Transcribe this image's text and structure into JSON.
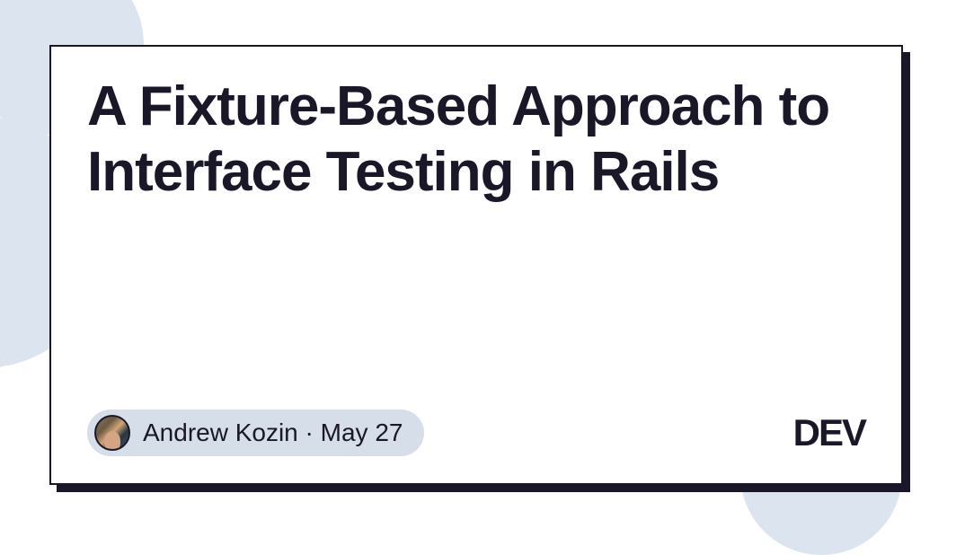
{
  "article": {
    "title": "A Fixture-Based Approach to Interface Testing in Rails"
  },
  "author": {
    "name": "Andrew Kozin",
    "separator": "·",
    "date": "May 27"
  },
  "brand": {
    "logo": "DEV"
  }
}
